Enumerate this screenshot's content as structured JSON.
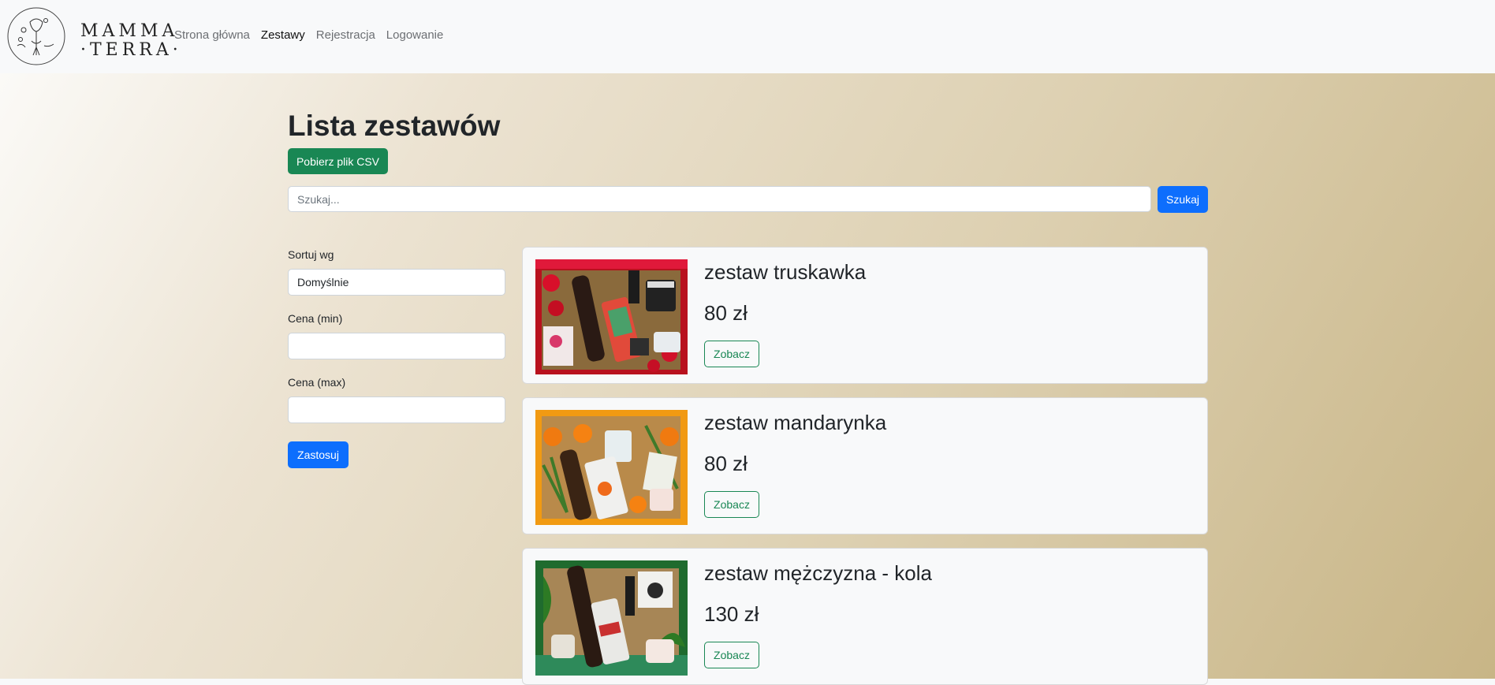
{
  "brand": {
    "line1": "MAMMA",
    "line2": "·TERRA·"
  },
  "nav": {
    "items": [
      {
        "label": "Strona główna",
        "active": false
      },
      {
        "label": "Zestawy",
        "active": true
      },
      {
        "label": "Rejestracja",
        "active": false
      },
      {
        "label": "Logowanie",
        "active": false
      }
    ]
  },
  "page": {
    "title": "Lista zestawów",
    "csv_button": "Pobierz plik CSV",
    "search_placeholder": "Szukaj...",
    "search_button": "Szukaj"
  },
  "filters": {
    "sort_label": "Sortuj wg",
    "sort_value": "Domyślnie",
    "price_min_label": "Cena (min)",
    "price_max_label": "Cena (max)",
    "apply_button": "Zastosuj"
  },
  "products": [
    {
      "name": "zestaw truskawka",
      "price": "80 zł",
      "button": "Zobacz"
    },
    {
      "name": "zestaw mandarynka",
      "price": "80 zł",
      "button": "Zobacz"
    },
    {
      "name": "zestaw mężczyzna - kola",
      "price": "130 zł",
      "button": "Zobacz"
    }
  ],
  "colors": {
    "primary": "#0d6efd",
    "success": "#198754",
    "navbar_bg": "#f8f9fa"
  }
}
